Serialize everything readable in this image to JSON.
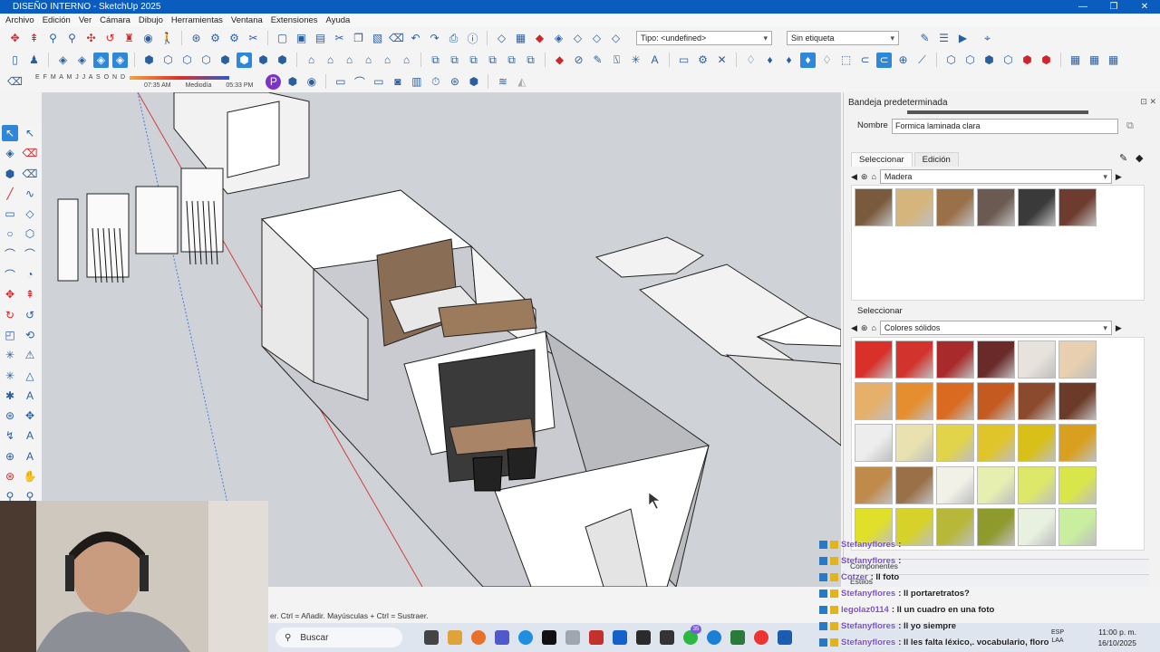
{
  "window": {
    "title": "DISEÑO INTERNO - SketchUp 2025"
  },
  "menu": [
    "Archivo",
    "Edición",
    "Ver",
    "Cámara",
    "Dibujo",
    "Herramientas",
    "Ventana",
    "Extensiones",
    "Ayuda"
  ],
  "toolbar": {
    "tipo_dropdown": "Tipo: <undefined>",
    "etiqueta_dropdown": "Sin etiqueta",
    "shadow_months": "E F M A M J J A S O N D",
    "shadow_time_start": "07:35 AM",
    "shadow_time_mid": "Mediodía",
    "shadow_time_end": "05:33 PM"
  },
  "tray": {
    "title": "Bandeja predeterminada",
    "name_label": "Nombre",
    "name_value": "Formica laminada clara",
    "tab_select": "Seleccionar",
    "tab_edit": "Edición",
    "library_1": "Madera",
    "section2_label": "Seleccionar",
    "library_2": "Colores sólidos",
    "wood_swatches": [
      "#7a5a3c",
      "#d6b57c",
      "#9a7049",
      "#6b5a52",
      "#3a3a3a",
      "#6e3c2e"
    ],
    "solid_swatches": [
      "#d9302a",
      "#d2332c",
      "#a82a2a",
      "#6a2a2a",
      "#e8e2dc",
      "#e7cfb0",
      "#e6b06a",
      "#e58e2f",
      "#d96a1f",
      "#c45a20",
      "#8c4a2c",
      "#6c3a28",
      "#ededed",
      "#e9e2b0",
      "#e1d34a",
      "#e0c52a",
      "#d8c018",
      "#d9a020",
      "#c08a4a",
      "#9a7048",
      "#f1f1e8",
      "#e7efb0",
      "#dde86a",
      "#d9e64a",
      "#e0e02a",
      "#d6d22a",
      "#b7b83a",
      "#8f9a2c",
      "#e8f1e0",
      "#c9eea0"
    ],
    "panel_components": "Componentes",
    "panel_styles": "Estilos"
  },
  "status": {
    "text": "er. Ctrl = Añadir. Mayúsculas + Ctrl = Sustraer."
  },
  "taskbar": {
    "search_placeholder": "Buscar",
    "lang": "ESP",
    "lang2": "LAA",
    "time": "11:00 p. m.",
    "date": "16/10/2025",
    "badge": "35"
  },
  "chat": [
    {
      "user": "Stefanyflores",
      "msg": ":"
    },
    {
      "user": "Stefanyflores",
      "msg": ":"
    },
    {
      "user": "Cotzer",
      "msg": ": ll foto"
    },
    {
      "user": "Stefanyflores",
      "msg": ": ll portaretratos?"
    },
    {
      "user": "legolaz0114",
      "msg": ": ll un cuadro en una foto"
    },
    {
      "user": "Stefanyflores",
      "msg": ": ll yo siempre"
    },
    {
      "user": "Stefanyflores",
      "msg": ": ll les falta léxico,. vocabulario, floro"
    }
  ]
}
